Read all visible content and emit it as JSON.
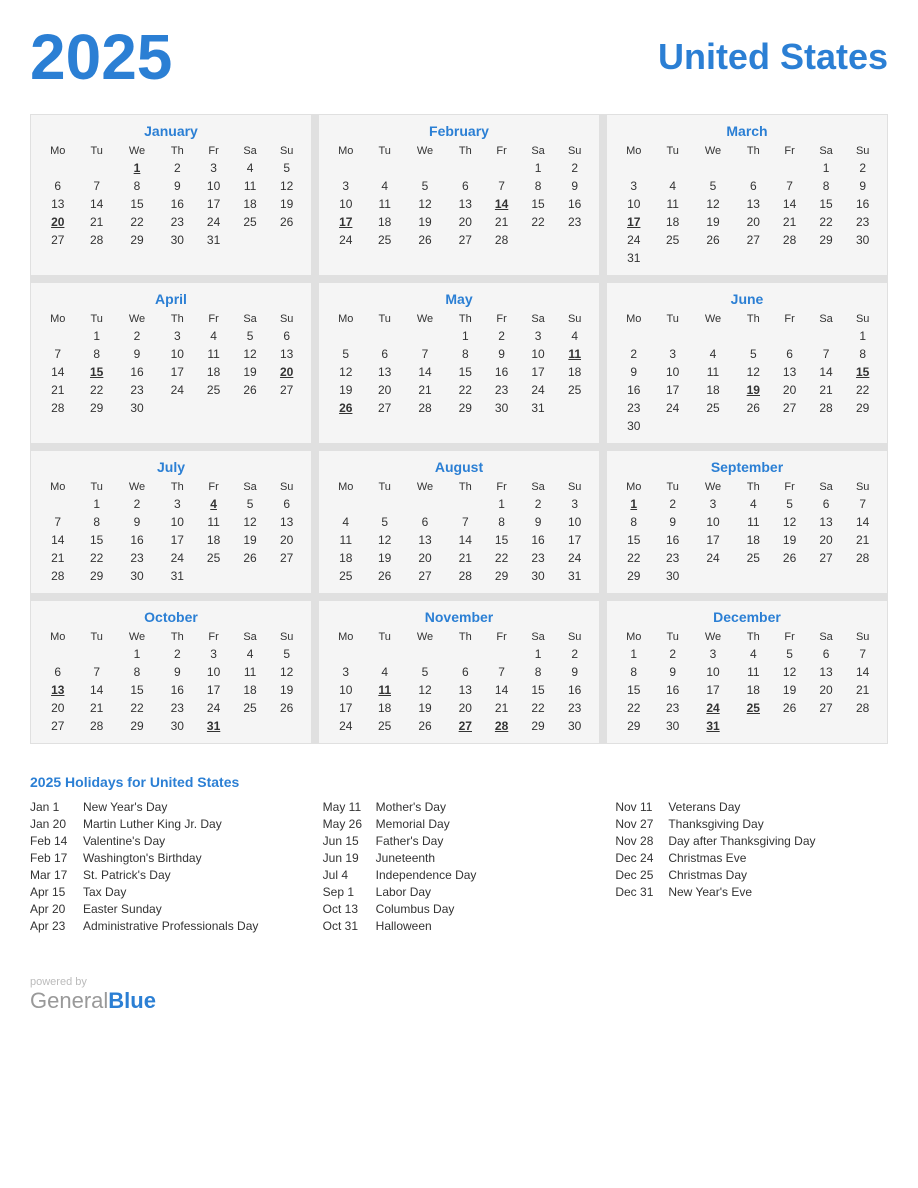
{
  "header": {
    "year": "2025",
    "country": "United States"
  },
  "months": [
    {
      "name": "January",
      "days_header": [
        "Mo",
        "Tu",
        "We",
        "Th",
        "Fr",
        "Sa",
        "Su"
      ],
      "weeks": [
        [
          "",
          "",
          "1",
          "2",
          "3",
          "4",
          "5"
        ],
        [
          "6",
          "7",
          "8",
          "9",
          "10",
          "11",
          "12"
        ],
        [
          "13",
          "14",
          "15",
          "16",
          "17",
          "18",
          "19"
        ],
        [
          "20",
          "21",
          "22",
          "23",
          "24",
          "25",
          "26"
        ],
        [
          "27",
          "28",
          "29",
          "30",
          "31",
          "",
          ""
        ]
      ],
      "holidays": [
        "1",
        "20"
      ]
    },
    {
      "name": "February",
      "days_header": [
        "Mo",
        "Tu",
        "We",
        "Th",
        "Fr",
        "Sa",
        "Su"
      ],
      "weeks": [
        [
          "",
          "",
          "",
          "",
          "",
          "1",
          "2"
        ],
        [
          "3",
          "4",
          "5",
          "6",
          "7",
          "8",
          "9"
        ],
        [
          "10",
          "11",
          "12",
          "13",
          "14",
          "15",
          "16"
        ],
        [
          "17",
          "18",
          "19",
          "20",
          "21",
          "22",
          "23"
        ],
        [
          "24",
          "25",
          "26",
          "27",
          "28",
          "",
          ""
        ]
      ],
      "holidays": [
        "14",
        "17"
      ]
    },
    {
      "name": "March",
      "days_header": [
        "Mo",
        "Tu",
        "We",
        "Th",
        "Fr",
        "Sa",
        "Su"
      ],
      "weeks": [
        [
          "",
          "",
          "",
          "",
          "",
          "1",
          "2"
        ],
        [
          "3",
          "4",
          "5",
          "6",
          "7",
          "8",
          "9"
        ],
        [
          "10",
          "11",
          "12",
          "13",
          "14",
          "15",
          "16"
        ],
        [
          "17",
          "18",
          "19",
          "20",
          "21",
          "22",
          "23"
        ],
        [
          "24",
          "25",
          "26",
          "27",
          "28",
          "29",
          "30"
        ],
        [
          "31",
          "",
          "",
          "",
          "",
          "",
          ""
        ]
      ],
      "holidays": [
        "17"
      ]
    },
    {
      "name": "April",
      "days_header": [
        "Mo",
        "Tu",
        "We",
        "Th",
        "Fr",
        "Sa",
        "Su"
      ],
      "weeks": [
        [
          "",
          "1",
          "2",
          "3",
          "4",
          "5",
          "6"
        ],
        [
          "7",
          "8",
          "9",
          "10",
          "11",
          "12",
          "13"
        ],
        [
          "14",
          "15",
          "16",
          "17",
          "18",
          "19",
          "20"
        ],
        [
          "21",
          "22",
          "23",
          "24",
          "25",
          "26",
          "27"
        ],
        [
          "28",
          "29",
          "30",
          "",
          "",
          "",
          ""
        ]
      ],
      "holidays": [
        "15",
        "20"
      ]
    },
    {
      "name": "May",
      "days_header": [
        "Mo",
        "Tu",
        "We",
        "Th",
        "Fr",
        "Sa",
        "Su"
      ],
      "weeks": [
        [
          "",
          "",
          "",
          "1",
          "2",
          "3",
          "4"
        ],
        [
          "5",
          "6",
          "7",
          "8",
          "9",
          "10",
          "11"
        ],
        [
          "12",
          "13",
          "14",
          "15",
          "16",
          "17",
          "18"
        ],
        [
          "19",
          "20",
          "21",
          "22",
          "23",
          "24",
          "25"
        ],
        [
          "26",
          "27",
          "28",
          "29",
          "30",
          "31",
          ""
        ]
      ],
      "holidays": [
        "11",
        "26"
      ]
    },
    {
      "name": "June",
      "days_header": [
        "Mo",
        "Tu",
        "We",
        "Th",
        "Fr",
        "Sa",
        "Su"
      ],
      "weeks": [
        [
          "",
          "",
          "",
          "",
          "",
          "",
          "1"
        ],
        [
          "2",
          "3",
          "4",
          "5",
          "6",
          "7",
          "8"
        ],
        [
          "9",
          "10",
          "11",
          "12",
          "13",
          "14",
          "15"
        ],
        [
          "16",
          "17",
          "18",
          "19",
          "20",
          "21",
          "22"
        ],
        [
          "23",
          "24",
          "25",
          "26",
          "27",
          "28",
          "29"
        ],
        [
          "30",
          "",
          "",
          "",
          "",
          "",
          ""
        ]
      ],
      "holidays": [
        "15",
        "19"
      ]
    },
    {
      "name": "July",
      "days_header": [
        "Mo",
        "Tu",
        "We",
        "Th",
        "Fr",
        "Sa",
        "Su"
      ],
      "weeks": [
        [
          "",
          "1",
          "2",
          "3",
          "4",
          "5",
          "6"
        ],
        [
          "7",
          "8",
          "9",
          "10",
          "11",
          "12",
          "13"
        ],
        [
          "14",
          "15",
          "16",
          "17",
          "18",
          "19",
          "20"
        ],
        [
          "21",
          "22",
          "23",
          "24",
          "25",
          "26",
          "27"
        ],
        [
          "28",
          "29",
          "30",
          "31",
          "",
          "",
          ""
        ]
      ],
      "holidays": [
        "4"
      ]
    },
    {
      "name": "August",
      "days_header": [
        "Mo",
        "Tu",
        "We",
        "Th",
        "Fr",
        "Sa",
        "Su"
      ],
      "weeks": [
        [
          "",
          "",
          "",
          "",
          "1",
          "2",
          "3"
        ],
        [
          "4",
          "5",
          "6",
          "7",
          "8",
          "9",
          "10"
        ],
        [
          "11",
          "12",
          "13",
          "14",
          "15",
          "16",
          "17"
        ],
        [
          "18",
          "19",
          "20",
          "21",
          "22",
          "23",
          "24"
        ],
        [
          "25",
          "26",
          "27",
          "28",
          "29",
          "30",
          "31"
        ]
      ],
      "holidays": []
    },
    {
      "name": "September",
      "days_header": [
        "Mo",
        "Tu",
        "We",
        "Th",
        "Fr",
        "Sa",
        "Su"
      ],
      "weeks": [
        [
          "1",
          "2",
          "3",
          "4",
          "5",
          "6",
          "7"
        ],
        [
          "8",
          "9",
          "10",
          "11",
          "12",
          "13",
          "14"
        ],
        [
          "15",
          "16",
          "17",
          "18",
          "19",
          "20",
          "21"
        ],
        [
          "22",
          "23",
          "24",
          "25",
          "26",
          "27",
          "28"
        ],
        [
          "29",
          "30",
          "",
          "",
          "",
          "",
          ""
        ]
      ],
      "holidays": [
        "1"
      ]
    },
    {
      "name": "October",
      "days_header": [
        "Mo",
        "Tu",
        "We",
        "Th",
        "Fr",
        "Sa",
        "Su"
      ],
      "weeks": [
        [
          "",
          "",
          "1",
          "2",
          "3",
          "4",
          "5"
        ],
        [
          "6",
          "7",
          "8",
          "9",
          "10",
          "11",
          "12"
        ],
        [
          "13",
          "14",
          "15",
          "16",
          "17",
          "18",
          "19"
        ],
        [
          "20",
          "21",
          "22",
          "23",
          "24",
          "25",
          "26"
        ],
        [
          "27",
          "28",
          "29",
          "30",
          "31",
          "",
          ""
        ]
      ],
      "holidays": [
        "13",
        "31"
      ]
    },
    {
      "name": "November",
      "days_header": [
        "Mo",
        "Tu",
        "We",
        "Th",
        "Fr",
        "Sa",
        "Su"
      ],
      "weeks": [
        [
          "",
          "",
          "",
          "",
          "",
          "1",
          "2"
        ],
        [
          "3",
          "4",
          "5",
          "6",
          "7",
          "8",
          "9"
        ],
        [
          "10",
          "11",
          "12",
          "13",
          "14",
          "15",
          "16"
        ],
        [
          "17",
          "18",
          "19",
          "20",
          "21",
          "22",
          "23"
        ],
        [
          "24",
          "25",
          "26",
          "27",
          "28",
          "29",
          "30"
        ]
      ],
      "holidays": [
        "11",
        "27",
        "28"
      ]
    },
    {
      "name": "December",
      "days_header": [
        "Mo",
        "Tu",
        "We",
        "Th",
        "Fr",
        "Sa",
        "Su"
      ],
      "weeks": [
        [
          "1",
          "2",
          "3",
          "4",
          "5",
          "6",
          "7"
        ],
        [
          "8",
          "9",
          "10",
          "11",
          "12",
          "13",
          "14"
        ],
        [
          "15",
          "16",
          "17",
          "18",
          "19",
          "20",
          "21"
        ],
        [
          "22",
          "23",
          "24",
          "25",
          "26",
          "27",
          "28"
        ],
        [
          "29",
          "30",
          "31",
          "",
          "",
          "",
          ""
        ]
      ],
      "holidays": [
        "24",
        "25",
        "31"
      ]
    }
  ],
  "holidays_section": {
    "title": "2025 Holidays for United States",
    "columns": [
      [
        {
          "date": "Jan 1",
          "name": "New Year's Day"
        },
        {
          "date": "Jan 20",
          "name": "Martin Luther King Jr. Day"
        },
        {
          "date": "Feb 14",
          "name": "Valentine's Day"
        },
        {
          "date": "Feb 17",
          "name": "Washington's Birthday"
        },
        {
          "date": "Mar 17",
          "name": "St. Patrick's Day"
        },
        {
          "date": "Apr 15",
          "name": "Tax Day"
        },
        {
          "date": "Apr 20",
          "name": "Easter Sunday"
        },
        {
          "date": "Apr 23",
          "name": "Administrative Professionals Day"
        }
      ],
      [
        {
          "date": "May 11",
          "name": "Mother's Day"
        },
        {
          "date": "May 26",
          "name": "Memorial Day"
        },
        {
          "date": "Jun 15",
          "name": "Father's Day"
        },
        {
          "date": "Jun 19",
          "name": "Juneteenth"
        },
        {
          "date": "Jul 4",
          "name": "Independence Day"
        },
        {
          "date": "Sep 1",
          "name": "Labor Day"
        },
        {
          "date": "Oct 13",
          "name": "Columbus Day"
        },
        {
          "date": "Oct 31",
          "name": "Halloween"
        }
      ],
      [
        {
          "date": "Nov 11",
          "name": "Veterans Day"
        },
        {
          "date": "Nov 27",
          "name": "Thanksgiving Day"
        },
        {
          "date": "Nov 28",
          "name": "Day after Thanksgiving Day"
        },
        {
          "date": "Dec 24",
          "name": "Christmas Eve"
        },
        {
          "date": "Dec 25",
          "name": "Christmas Day"
        },
        {
          "date": "Dec 31",
          "name": "New Year's Eve"
        }
      ]
    ]
  },
  "footer": {
    "powered_by": "powered by",
    "brand_general": "General",
    "brand_blue": "Blue"
  }
}
